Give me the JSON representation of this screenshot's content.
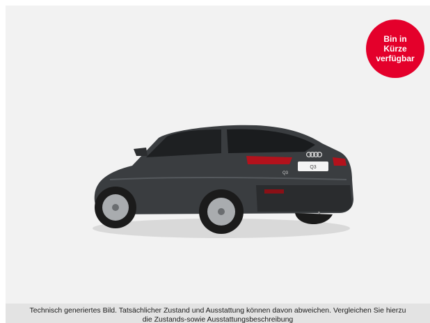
{
  "badge": {
    "line1": "Bin in",
    "line2": "Kürze",
    "line3": "verfügbar",
    "color": "#e4002b"
  },
  "car": {
    "plate_text": "Q3",
    "model_badge": "Q3",
    "logo": "audi-rings-icon"
  },
  "disclaimer": {
    "line1": "Technisch generiertes Bild. Tatsächlicher Zustand und Ausstattung können davon abweichen. Vergleichen Sie hierzu",
    "line2": "die Zustands-sowie Ausstattungsbeschreibung"
  },
  "colors": {
    "background": "#f2f2f2",
    "car_body": "#3a3d40",
    "disclaimer_bar": "#e3e3e3"
  }
}
